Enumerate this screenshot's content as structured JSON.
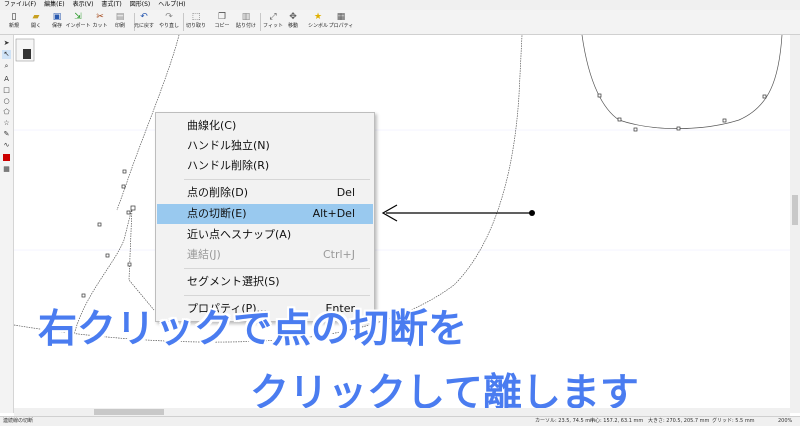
{
  "menubar": [
    "ファイル(F)",
    "編集(E)",
    "表示(V)",
    "書式(T)",
    "図形(S)",
    "ヘルプ(H)"
  ],
  "toolbar": [
    {
      "icon": "new-icon",
      "label": "新規"
    },
    {
      "icon": "open-icon",
      "label": "開く"
    },
    {
      "icon": "save-icon",
      "label": "保存"
    },
    {
      "icon": "insert-icon",
      "label": "インポート"
    },
    {
      "icon": "cut-icon",
      "label": "カット"
    },
    {
      "icon": "edit-icon",
      "label": "印刷"
    },
    {
      "icon": "undo-icon",
      "label": "元に戻す"
    },
    {
      "icon": "redo-icon",
      "label": "やり直し"
    },
    {
      "icon": "trim-icon",
      "label": "切り取り"
    },
    {
      "icon": "copy-icon",
      "label": "コピー"
    },
    {
      "icon": "paste-icon",
      "label": "貼り付け"
    },
    {
      "icon": "fit-icon",
      "label": "フィット"
    },
    {
      "icon": "move-icon",
      "label": "移動"
    },
    {
      "icon": "symbol-icon",
      "label": "シンボル"
    },
    {
      "icon": "property-icon",
      "label": "プロパティ"
    }
  ],
  "context_menu": {
    "items": [
      {
        "label": "曲線化(C)",
        "shortcut": "",
        "disabled": false,
        "highlighted": false
      },
      {
        "label": "ハンドル独立(N)",
        "shortcut": "",
        "disabled": false,
        "highlighted": false
      },
      {
        "label": "ハンドル削除(R)",
        "shortcut": "",
        "disabled": false,
        "highlighted": false
      },
      {
        "label": "点の削除(D)",
        "shortcut": "Del",
        "disabled": false,
        "highlighted": false
      },
      {
        "label": "点の切断(E)",
        "shortcut": "Alt+Del",
        "disabled": false,
        "highlighted": true
      },
      {
        "label": "近い点へスナップ(A)",
        "shortcut": "",
        "disabled": false,
        "highlighted": false
      },
      {
        "label": "連結(J)",
        "shortcut": "Ctrl+J",
        "disabled": true,
        "highlighted": false
      },
      {
        "label": "セグメント選択(S)",
        "shortcut": "",
        "disabled": false,
        "highlighted": false
      },
      {
        "label": "プロパティ(P)...",
        "shortcut": "Enter",
        "disabled": false,
        "highlighted": false
      }
    ]
  },
  "captions": {
    "line1": "右クリックで点の切断を",
    "line2": "クリックして離します"
  },
  "statusbar": {
    "left": "連続線の切断",
    "cursor": "カーソル: 23.5, 74.5 mm",
    "center": "中心: 157.2, 63.1 mm",
    "size": "大きさ: 270.5, 205.7 mm",
    "grid": "グリッド: 5.5 mm",
    "zoom": "200%"
  },
  "colors": {
    "caption": "#4a7cf0",
    "highlight": "#99c9ef",
    "accent_red": "#cc0000"
  }
}
